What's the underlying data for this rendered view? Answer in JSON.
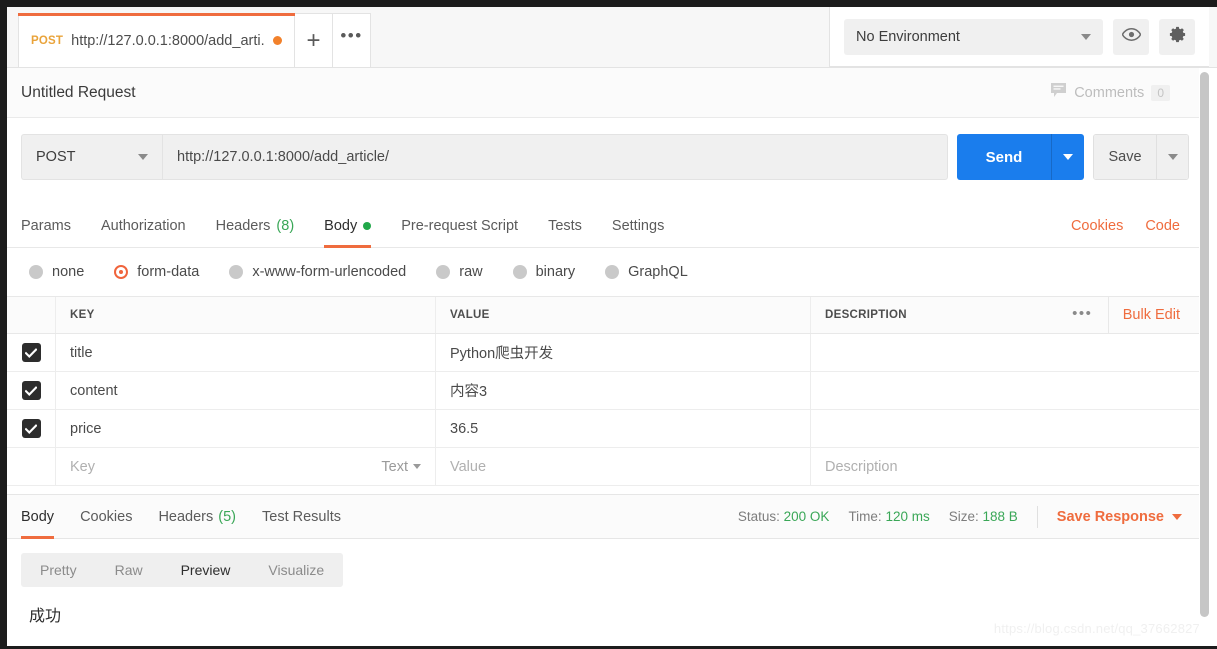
{
  "tabbar": {
    "request_tab": {
      "method": "POST",
      "url": "http://127.0.0.1:8000/add_arti...",
      "unsaved": true
    },
    "new_tab_label": "+",
    "more_label": "•••"
  },
  "environment": {
    "selected": "No Environment",
    "eye_icon": "eye-icon",
    "settings_icon": "gear-icon"
  },
  "header": {
    "request_title": "Untitled Request",
    "comments_label": "Comments",
    "comments_count": "0"
  },
  "url_bar": {
    "method": "POST",
    "url": "http://127.0.0.1:8000/add_article/",
    "send_label": "Send",
    "save_label": "Save"
  },
  "request_tabs": {
    "items": [
      {
        "label": "Params",
        "active": false
      },
      {
        "label": "Authorization",
        "active": false
      },
      {
        "label": "Headers",
        "count": "(8)",
        "active": false
      },
      {
        "label": "Body",
        "active": true,
        "dot": true
      },
      {
        "label": "Pre-request Script",
        "active": false
      },
      {
        "label": "Tests",
        "active": false
      },
      {
        "label": "Settings",
        "active": false
      }
    ],
    "cookies_link": "Cookies",
    "code_link": "Code"
  },
  "body_types": [
    {
      "label": "none",
      "selected": false
    },
    {
      "label": "form-data",
      "selected": true
    },
    {
      "label": "x-www-form-urlencoded",
      "selected": false
    },
    {
      "label": "raw",
      "selected": false
    },
    {
      "label": "binary",
      "selected": false
    },
    {
      "label": "GraphQL",
      "selected": false
    }
  ],
  "form_table": {
    "headers": {
      "key": "KEY",
      "value": "VALUE",
      "description": "DESCRIPTION"
    },
    "bulk_edit": "Bulk Edit",
    "dots": "•••",
    "rows": [
      {
        "checked": true,
        "key": "title",
        "value": "Python爬虫开发",
        "description": ""
      },
      {
        "checked": true,
        "key": "content",
        "value": "内容3",
        "description": ""
      },
      {
        "checked": true,
        "key": "price",
        "value": "36.5",
        "description": ""
      }
    ],
    "empty_row": {
      "key_placeholder": "Key",
      "type_label": "Text",
      "value_placeholder": "Value",
      "description_placeholder": "Description"
    }
  },
  "response": {
    "tabs": [
      {
        "label": "Body",
        "active": true
      },
      {
        "label": "Cookies",
        "active": false
      },
      {
        "label": "Headers",
        "count": "(5)",
        "active": false
      },
      {
        "label": "Test Results",
        "active": false
      }
    ],
    "status_label": "Status:",
    "status_value": "200 OK",
    "time_label": "Time:",
    "time_value": "120 ms",
    "size_label": "Size:",
    "size_value": "188 B",
    "save_response": "Save Response",
    "viewer_tabs": [
      {
        "label": "Pretty",
        "active": false
      },
      {
        "label": "Raw",
        "active": false
      },
      {
        "label": "Preview",
        "active": true
      },
      {
        "label": "Visualize",
        "active": false
      }
    ],
    "body_text": "成功"
  },
  "watermark": "https://blog.csdn.net/qq_37662827",
  "colors": {
    "accent_orange": "#ef6c3e",
    "send_blue": "#1a7ded",
    "status_green": "#3aa757",
    "method_amber": "#e9a33a"
  }
}
